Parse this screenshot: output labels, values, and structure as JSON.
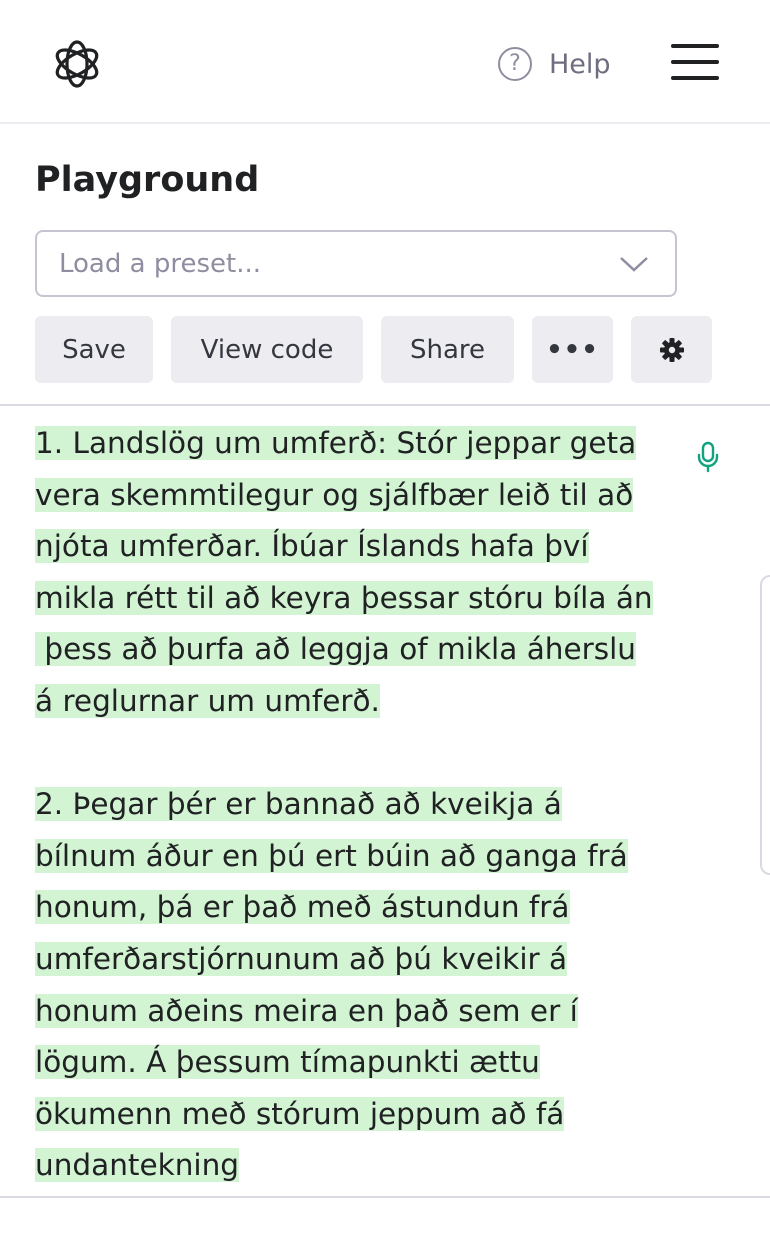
{
  "header": {
    "logo_icon": "openai-logo-icon",
    "help_icon": "question-circle-icon",
    "help_label": "Help",
    "menu_icon": "hamburger-menu-icon"
  },
  "page": {
    "title": "Playground"
  },
  "preset": {
    "placeholder": "Load a preset...",
    "icon": "chevron-down-icon"
  },
  "toolbar": {
    "save_label": "Save",
    "view_code_label": "View code",
    "share_label": "Share",
    "more_label": "•••",
    "settings_icon": "gear-icon"
  },
  "editor": {
    "mic_icon": "microphone-icon",
    "highlight_color": "#d2f4d3",
    "paragraphs": [
      [
        "1. Landslög um umferð: Stór jeppar geta",
        "vera skemmtilegur og sjálfbær leið til að",
        "njóta umferðar. Íbúar Íslands hafa því",
        "mikla rétt til að keyra þessar stóru bíla án",
        " þess að þurfa að leggja of mikla áherslu",
        "á reglurnar um umferð."
      ],
      [
        "2. Þegar þér er bannað að kveikja á",
        "bílnum áður en þú ert búin að ganga frá",
        "honum, þá er það með ástundun frá",
        "umferðarstjórnunum að þú kveikir á",
        "honum aðeins meira en það sem er í",
        "lögum. Á þessum tímapunkti ættu",
        "ökumenn með stórum jeppum að fá",
        "undantekning"
      ]
    ]
  },
  "colors": {
    "accent": "#10a37f",
    "button_bg": "#ececf1",
    "text": "#202123"
  }
}
